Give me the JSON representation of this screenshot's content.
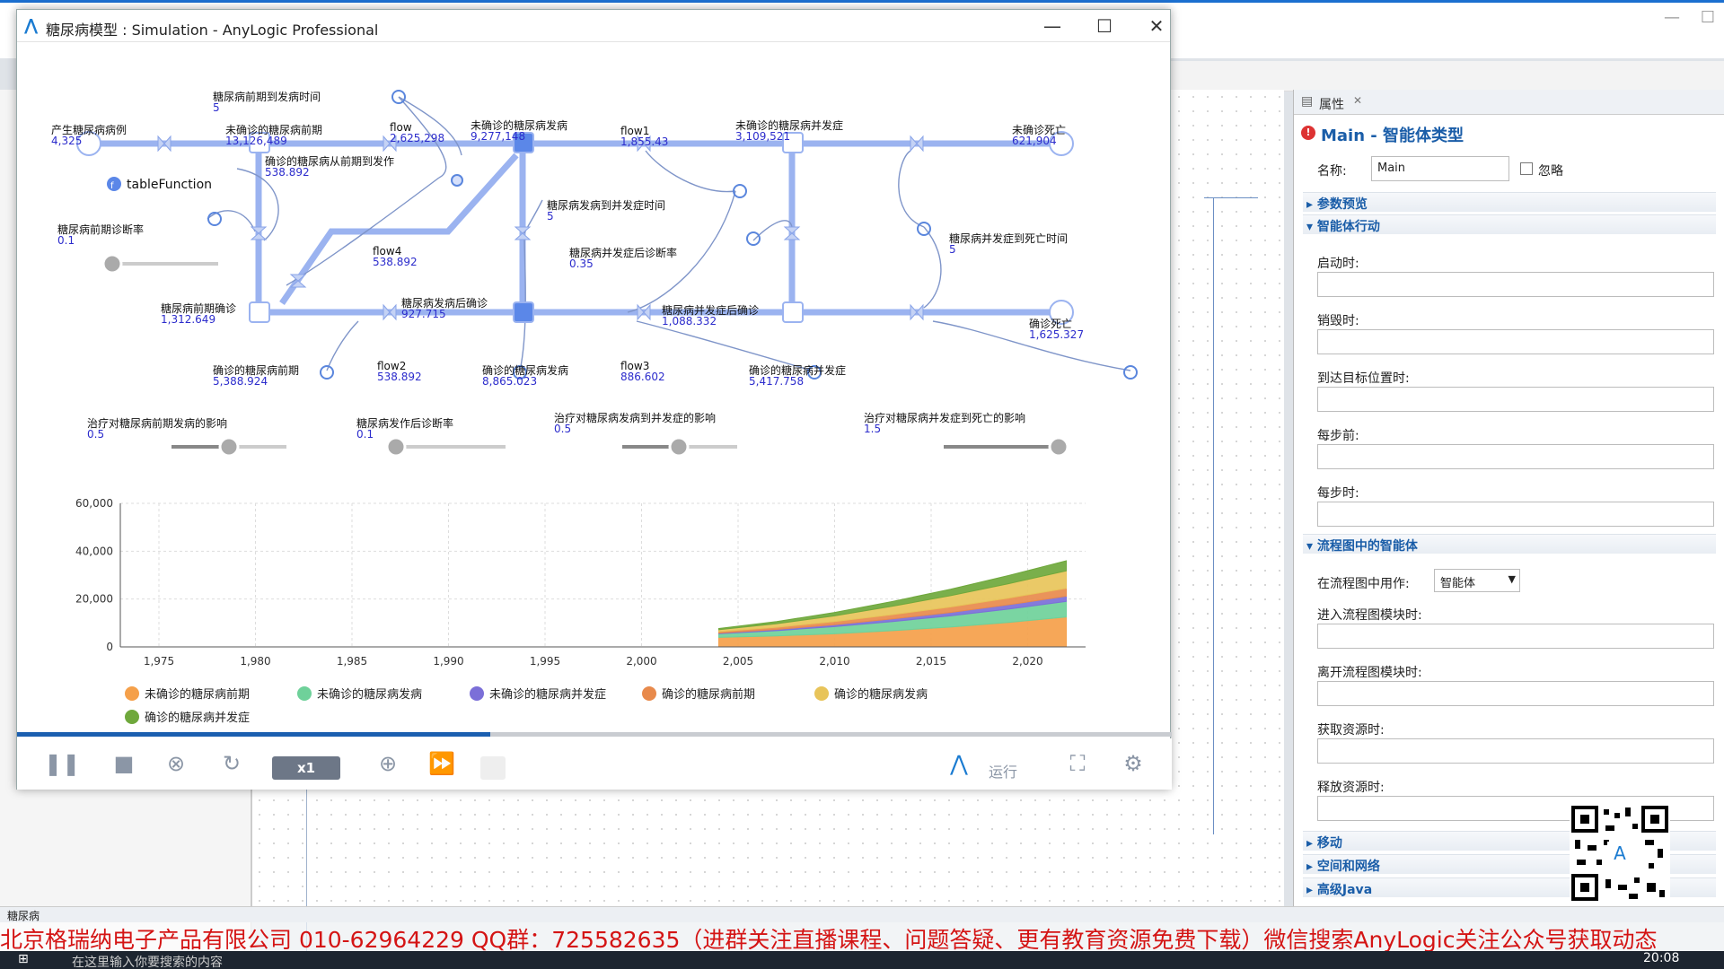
{
  "ide": {
    "left_tab": "糖尿病",
    "tray_time": "20:08",
    "taskbar_search": "在这里输入你要搜索的内容"
  },
  "props": {
    "tab_label": "属性",
    "title": "Main - 智能体类型",
    "name_label": "名称:",
    "name_value": "Main",
    "ignore_label": "忽略",
    "sections": {
      "params": "参数预览",
      "actions": "智能体行动",
      "flowchart": "流程图中的智能体",
      "move": "移动",
      "space": "空间和网络",
      "java": "高级Java"
    },
    "fields": [
      "启动时:",
      "销毁时:",
      "到达目标位置时:",
      "每步前:",
      "每步时:"
    ],
    "use_label": "在流程图中用作:",
    "use_value": "智能体",
    "fields2": [
      "进入流程图模块时:",
      "离开流程图模块时:",
      "获取资源时:",
      "释放资源时:"
    ]
  },
  "sim": {
    "title": "糖尿病模型 : Simulation - AnyLogic Professional",
    "speed": "x1",
    "run_label": "运行",
    "progress": 0.41
  },
  "sd": {
    "labels": {
      "delay1": "糖尿病前期到发病时间",
      "delay1_v": "5",
      "gen": "产生糖尿病病例",
      "gen_v": "4,325",
      "undiag_pre": "未确诊的糖尿病前期",
      "undiag_pre_v": "13,126,489",
      "flow": "flow",
      "flow_v": "2,625,298",
      "undiag_dis": "未确诊的糖尿病发病",
      "undiag_dis_v": "9,277,148",
      "flow1": "flow1",
      "flow1_v": "1,855.43",
      "undiag_comp": "未确诊的糖尿病并发症",
      "undiag_comp_v": "3,109,521",
      "undiag_death": "未确诊死亡",
      "undiag_death_v": "621,904",
      "diag_pre_to_dis": "确诊的糖尿病从前期到发作",
      "diag_pre_to_dis_v": "538.892",
      "table_fn": "tableFunction",
      "pre_diag_rate": "糖尿病前期诊断率",
      "pre_diag_rate_v": "0.1",
      "dis_to_comp": "糖尿病发病到并发症时间",
      "dis_to_comp_v": "5",
      "comp_diag_rate": "糖尿病并发症后诊断率",
      "comp_diag_rate_v": "0.35",
      "comp_to_death": "糖尿病并发症到死亡时间",
      "comp_to_death_v": "5",
      "flow4": "flow4",
      "flow4_v": "538.892",
      "pre_diag": "糖尿病前期确诊",
      "pre_diag_v": "1,312.649",
      "dis_after_diag": "糖尿病发病后确诊",
      "dis_after_diag_v": "927.715",
      "comp_after_diag": "糖尿病并发症后确诊",
      "comp_after_diag_v": "1,088.332",
      "diag_death": "确诊死亡",
      "diag_death_v": "1,625.327",
      "diag_pre": "确诊的糖尿病前期",
      "diag_pre_v": "5,388.924",
      "flow2": "flow2",
      "flow2_v": "538.892",
      "diag_dis": "确诊的糖尿病发病",
      "diag_dis_v": "8,865.023",
      "flow3": "flow3",
      "flow3_v": "886.602",
      "diag_comp": "确诊的糖尿病并发症",
      "diag_comp_v": "5,417.758",
      "treat_pre": "治疗对糖尿病前期发病的影响",
      "treat_pre_v": "0.5",
      "post_onset_rate": "糖尿病发作后诊断率",
      "post_onset_rate_v": "0.1",
      "treat_dis": "治疗对糖尿病发病到并发症的影响",
      "treat_dis_v": "0.5",
      "treat_comp": "治疗对糖尿病并发症到死亡的影响",
      "treat_comp_v": "1.5"
    },
    "sliders": {
      "pre_diag_rate": 0.05,
      "treat_pre": 0.5,
      "post_onset_rate": 0.05,
      "treat_dis": 0.5,
      "treat_comp": 1.0
    }
  },
  "chart_data": {
    "type": "area",
    "stacked": true,
    "x": [
      2004,
      2007,
      2010,
      2013,
      2016,
      2019,
      2022
    ],
    "xlim": [
      1973,
      2023
    ],
    "ylim": [
      0,
      60000
    ],
    "xticks": [
      "1,975",
      "1,980",
      "1,985",
      "1,990",
      "1,995",
      "2,000",
      "2,005",
      "2,010",
      "2,015",
      "2,020"
    ],
    "yticks": [
      "60,000",
      "40,000",
      "20,000",
      "0"
    ],
    "grid": true,
    "legend_position": "bottom",
    "series": [
      {
        "name": "未确诊的糖尿病前期",
        "color": "#f5a04a",
        "values": [
          4000,
          4600,
          5500,
          6800,
          8300,
          10200,
          12500
        ]
      },
      {
        "name": "未确诊的糖尿病发病",
        "color": "#6fd19a",
        "values": [
          1500,
          2200,
          3000,
          3800,
          4700,
          5600,
          6500
        ]
      },
      {
        "name": "未确诊的糖尿病并发症",
        "color": "#7b6fd8",
        "values": [
          300,
          500,
          800,
          1100,
          1400,
          1800,
          2200
        ]
      },
      {
        "name": "确诊的糖尿病前期",
        "color": "#e88a4c",
        "values": [
          600,
          900,
          1300,
          1800,
          2300,
          2800,
          3300
        ]
      },
      {
        "name": "确诊的糖尿病发病",
        "color": "#e8c45a",
        "values": [
          800,
          1500,
          2400,
          3500,
          4700,
          6000,
          7300
        ]
      },
      {
        "name": "确诊的糖尿病并发症",
        "color": "#6fa83c",
        "values": [
          500,
          900,
          1400,
          2000,
          2700,
          3400,
          4200
        ]
      }
    ]
  },
  "banner": "北京格瑞纳电子产品有限公司 010-62964229  QQ群：725582635（进群关注直播课程、问题答疑、更有教育资源免费下载）微信搜索AnyLogic关注公众号获取动态"
}
